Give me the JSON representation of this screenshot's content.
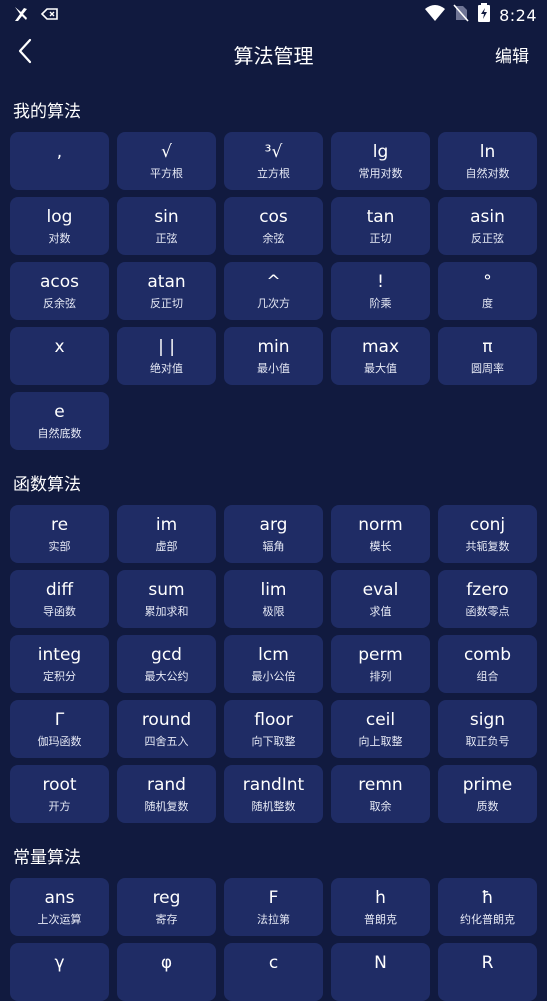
{
  "status_bar": {
    "time": "8:24"
  },
  "header": {
    "title": "算法管理",
    "edit_label": "编辑"
  },
  "sections": [
    {
      "title": "我的算法",
      "items": [
        {
          "symbol": ",",
          "label": ""
        },
        {
          "symbol": "√",
          "label": "平方根"
        },
        {
          "symbol": "³√",
          "label": "立方根"
        },
        {
          "symbol": "lg",
          "label": "常用对数"
        },
        {
          "symbol": "ln",
          "label": "自然对数"
        },
        {
          "symbol": "log",
          "label": "对数"
        },
        {
          "symbol": "sin",
          "label": "正弦"
        },
        {
          "symbol": "cos",
          "label": "余弦"
        },
        {
          "symbol": "tan",
          "label": "正切"
        },
        {
          "symbol": "asin",
          "label": "反正弦"
        },
        {
          "symbol": "acos",
          "label": "反余弦"
        },
        {
          "symbol": "atan",
          "label": "反正切"
        },
        {
          "symbol": "^",
          "label": "几次方"
        },
        {
          "symbol": "!",
          "label": "阶乘"
        },
        {
          "symbol": "°",
          "label": "度"
        },
        {
          "symbol": "x",
          "label": ""
        },
        {
          "symbol": "| |",
          "label": "绝对值"
        },
        {
          "symbol": "min",
          "label": "最小值"
        },
        {
          "symbol": "max",
          "label": "最大值"
        },
        {
          "symbol": "π",
          "label": "圆周率"
        },
        {
          "symbol": "e",
          "label": "自然底数"
        }
      ]
    },
    {
      "title": "函数算法",
      "items": [
        {
          "symbol": "re",
          "label": "实部"
        },
        {
          "symbol": "im",
          "label": "虚部"
        },
        {
          "symbol": "arg",
          "label": "辐角"
        },
        {
          "symbol": "norm",
          "label": "模长"
        },
        {
          "symbol": "conj",
          "label": "共轭复数"
        },
        {
          "symbol": "diff",
          "label": "导函数"
        },
        {
          "symbol": "sum",
          "label": "累加求和"
        },
        {
          "symbol": "lim",
          "label": "极限"
        },
        {
          "symbol": "eval",
          "label": "求值"
        },
        {
          "symbol": "fzero",
          "label": "函数零点"
        },
        {
          "symbol": "integ",
          "label": "定积分"
        },
        {
          "symbol": "gcd",
          "label": "最大公约"
        },
        {
          "symbol": "lcm",
          "label": "最小公倍"
        },
        {
          "symbol": "perm",
          "label": "排列"
        },
        {
          "symbol": "comb",
          "label": "组合"
        },
        {
          "symbol": "Γ",
          "label": "伽玛函数"
        },
        {
          "symbol": "round",
          "label": "四舍五入"
        },
        {
          "symbol": "floor",
          "label": "向下取整"
        },
        {
          "symbol": "ceil",
          "label": "向上取整"
        },
        {
          "symbol": "sign",
          "label": "取正负号"
        },
        {
          "symbol": "root",
          "label": "开方"
        },
        {
          "symbol": "rand",
          "label": "随机复数"
        },
        {
          "symbol": "randInt",
          "label": "随机整数"
        },
        {
          "symbol": "remn",
          "label": "取余"
        },
        {
          "symbol": "prime",
          "label": "质数"
        }
      ]
    },
    {
      "title": "常量算法",
      "items": [
        {
          "symbol": "ans",
          "label": "上次运算"
        },
        {
          "symbol": "reg",
          "label": "寄存"
        },
        {
          "symbol": "F",
          "label": "法拉第"
        },
        {
          "symbol": "h",
          "label": "普朗克"
        },
        {
          "symbol": "ħ",
          "label": "约化普朗克"
        },
        {
          "symbol": "γ",
          "label": ""
        },
        {
          "symbol": "φ",
          "label": ""
        },
        {
          "symbol": "c",
          "label": ""
        },
        {
          "symbol": "N",
          "label": ""
        },
        {
          "symbol": "R",
          "label": ""
        }
      ]
    }
  ],
  "colors": {
    "background": "#111a3f",
    "cell": "#1f2c65",
    "text": "#ffffff"
  }
}
